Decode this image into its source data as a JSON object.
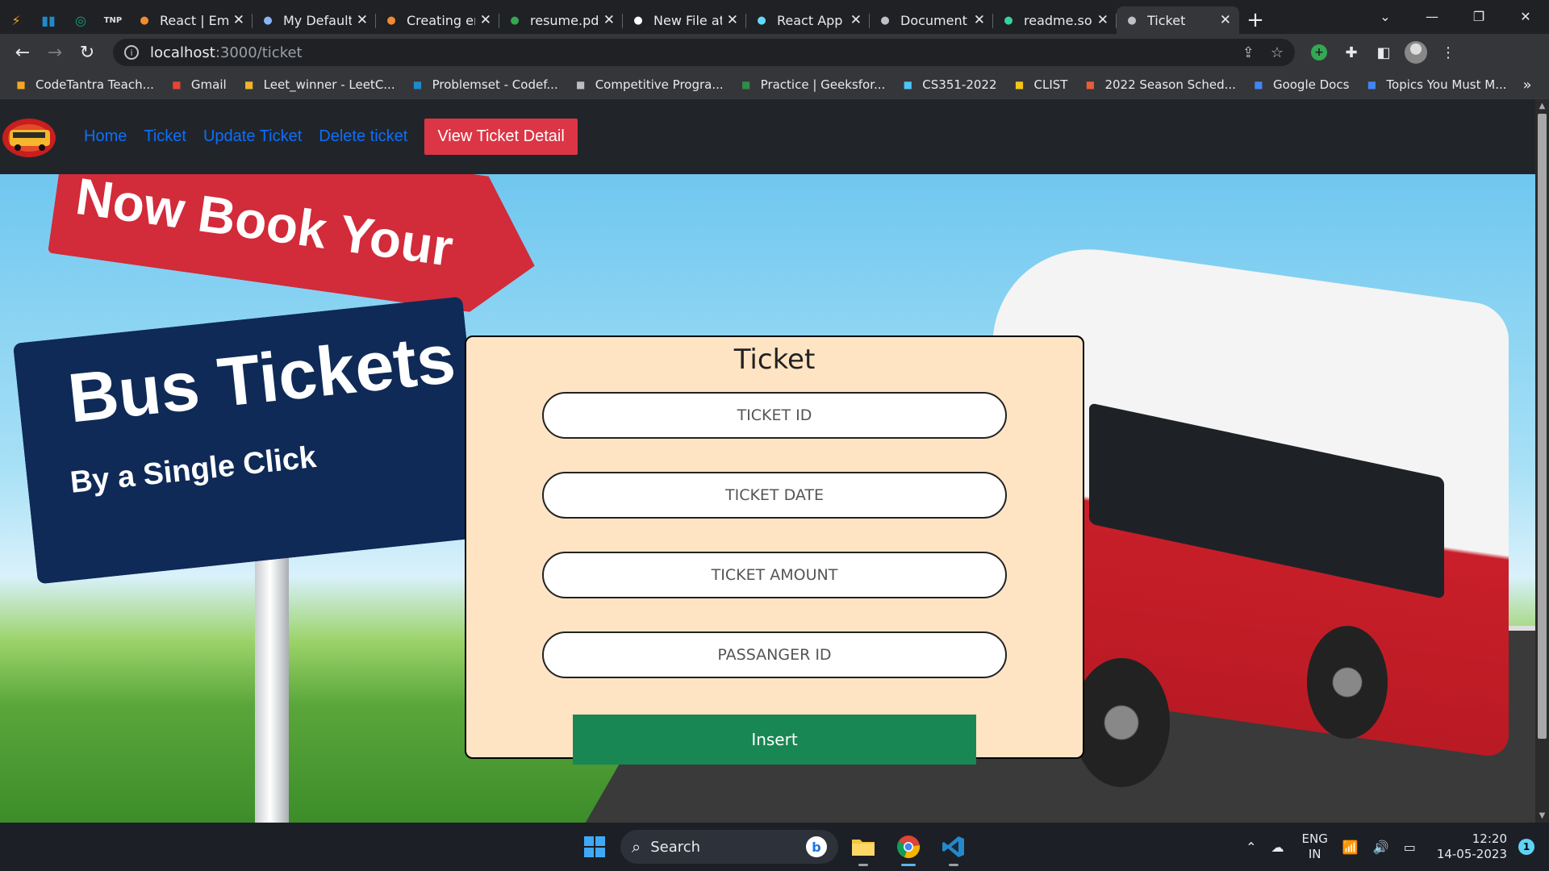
{
  "browser": {
    "tabs": [
      {
        "title": "React | Ema",
        "icon": "postman-icon",
        "color": "#f28b30"
      },
      {
        "title": "My Default",
        "icon": "visual-studio-icon",
        "color": "#8ab4f8"
      },
      {
        "title": "Creating er",
        "icon": "postman-icon",
        "color": "#f28b30"
      },
      {
        "title": "resume.pd",
        "icon": "google-drive-icon",
        "color": "#34a853"
      },
      {
        "title": "New File at",
        "icon": "github-icon",
        "color": "#ffffff"
      },
      {
        "title": "React App",
        "icon": "react-icon",
        "color": "#61dafb"
      },
      {
        "title": "Document",
        "icon": "globe-icon",
        "color": "#bdc1c6"
      },
      {
        "title": "readme.so",
        "icon": "readme-icon",
        "color": "#34d399"
      },
      {
        "title": "Ticket",
        "icon": "globe-icon",
        "color": "#bdc1c6",
        "active": true
      }
    ],
    "url_host": "localhost",
    "url_path": ":3000/ticket",
    "bookmarks": [
      {
        "label": "CodeTantra Teach...",
        "icon": "codetantra-icon",
        "color": "#f5a623"
      },
      {
        "label": "Gmail",
        "icon": "gmail-icon",
        "color": "#ea4335"
      },
      {
        "label": "Leet_winner - LeetC...",
        "icon": "leetcode-icon",
        "color": "#f0b429"
      },
      {
        "label": "Problemset - Codef...",
        "icon": "codeforces-icon",
        "color": "#1f8acb"
      },
      {
        "label": "Competitive Progra...",
        "icon": "codechef-icon",
        "color": "#bdbdbd"
      },
      {
        "label": "Practice | Geeksfor...",
        "icon": "geeksforgeeks-icon",
        "color": "#2f8d46"
      },
      {
        "label": "CS351-2022",
        "icon": "classroom-icon",
        "color": "#4fc3f7"
      },
      {
        "label": "CLIST",
        "icon": "clist-icon",
        "color": "#f5c518"
      },
      {
        "label": "2022 Season Sched...",
        "icon": "schedule-icon",
        "color": "#e85d3a"
      },
      {
        "label": "Google Docs",
        "icon": "google-docs-icon",
        "color": "#4285f4"
      },
      {
        "label": "Topics You Must M...",
        "icon": "google-docs-icon",
        "color": "#4285f4"
      }
    ]
  },
  "app": {
    "nav": {
      "home": "Home",
      "ticket": "Ticket",
      "update": "Update Ticket",
      "delete": "Delete ticket",
      "view_detail": "View Ticket Detail"
    },
    "hero": {
      "sign_top": "Now Book Your",
      "sign_title": "Bus Tickets",
      "sign_sub": "By a Single Click"
    },
    "form": {
      "title": "Ticket",
      "ticket_id_placeholder": "TICKET ID",
      "ticket_date_placeholder": "TICKET DATE",
      "ticket_amount_placeholder": "TICKET AMOUNT",
      "passenger_id_placeholder": "PASSANGER ID",
      "submit_label": "Insert"
    }
  },
  "taskbar": {
    "search_label": "Search",
    "lang_line1": "ENG",
    "lang_line2": "IN",
    "time": "12:20",
    "date": "14-05-2023",
    "notification_count": "1"
  }
}
